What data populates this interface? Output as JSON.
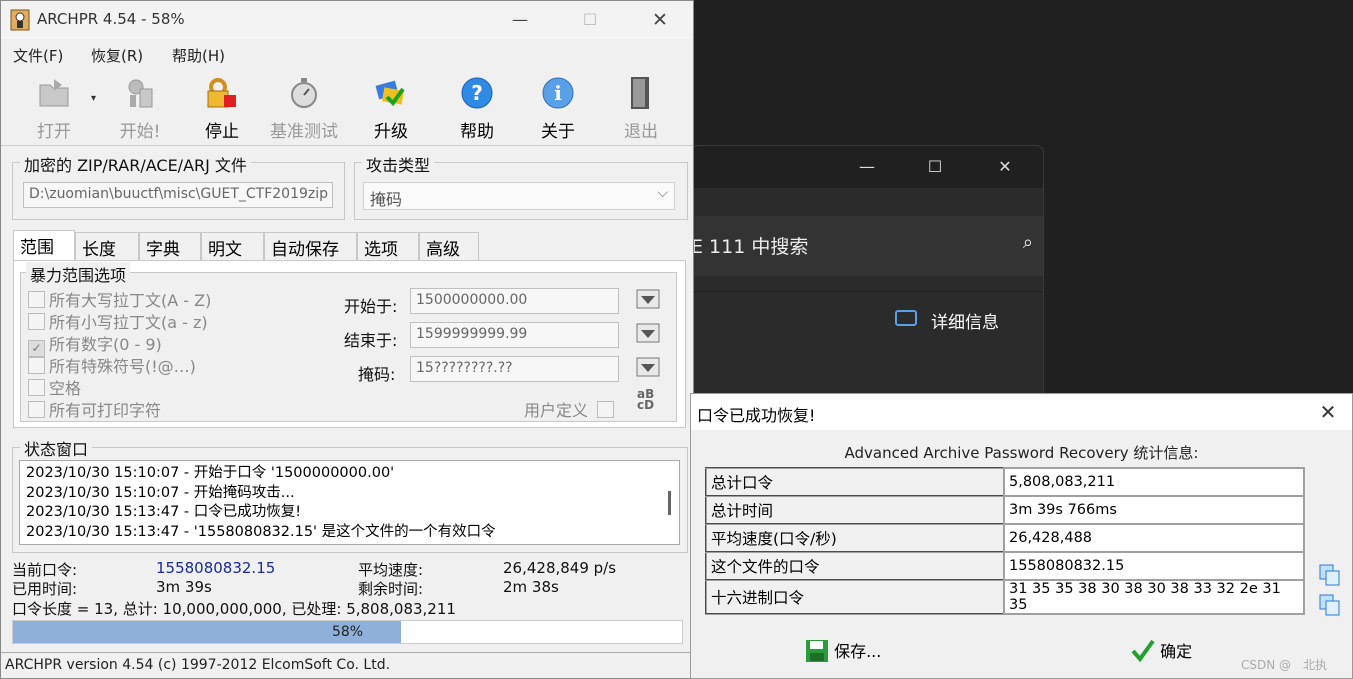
{
  "app": {
    "title": "ARCHPR 4.54 - 58%",
    "menu": [
      "文件(F)",
      "恢复(R)",
      "帮助(H)"
    ],
    "toolbar": [
      {
        "label": "打开",
        "icon": "open-folder-icon",
        "enabled": false
      },
      {
        "label": "开始!",
        "icon": "start-icon",
        "enabled": false
      },
      {
        "label": "停止",
        "icon": "stop-lock-icon",
        "enabled": true
      },
      {
        "label": "基准测试",
        "icon": "stopwatch-icon",
        "enabled": false
      },
      {
        "label": "升级",
        "icon": "upgrade-icon",
        "enabled": true
      },
      {
        "label": "帮助",
        "icon": "help-icon",
        "enabled": true
      },
      {
        "label": "关于",
        "icon": "info-icon",
        "enabled": true
      },
      {
        "label": "退出",
        "icon": "exit-door-icon",
        "enabled": false
      }
    ],
    "file_group": {
      "label": "加密的 ZIP/RAR/ACE/ARJ 文件",
      "path": "D:\\zuomian\\buuctf\\misc\\GUET_CTF2019zip"
    },
    "attack_group": {
      "label": "攻击类型",
      "selected": "掩码"
    },
    "tabs": [
      "范围",
      "长度",
      "字典",
      "明文",
      "自动保存",
      "选项",
      "高级"
    ],
    "range": {
      "group_label": "暴力范围选项",
      "checkboxes": [
        {
          "label": "所有大写拉丁文(A - Z)",
          "checked": false
        },
        {
          "label": "所有小写拉丁文(a - z)",
          "checked": false
        },
        {
          "label": "所有数字(0 - 9)",
          "checked": true
        },
        {
          "label": "所有特殊符号(!@…)",
          "checked": false
        },
        {
          "label": "空格",
          "checked": false
        },
        {
          "label": "所有可打印字符",
          "checked": false
        }
      ],
      "start_label": "开始于:",
      "start_value": "1500000000.00",
      "end_label": "结束于:",
      "end_value": "1599999999.99",
      "mask_label": "掩码:",
      "mask_value": "15????????.??",
      "custom_label": "用户定义"
    },
    "status_window": {
      "label": "状态窗口",
      "lines": [
        "2023/10/30 15:10:07 - 开始于口令 '1500000000.00'",
        "2023/10/30 15:10:07 - 开始掩码攻击...",
        "2023/10/30 15:13:47 - 口令已成功恢复!",
        "2023/10/30 15:13:47 - '1558080832.15' 是这个文件的一个有效口令"
      ]
    },
    "stats": {
      "current_label": "当前口令:",
      "current_value": "1558080832.15",
      "speed_label": "平均速度:",
      "speed_value": "26,428,849 p/s",
      "elapsed_label": "已用时间:",
      "elapsed_value": "3m 39s",
      "remaining_label": "剩余时间:",
      "remaining_value": "2m 38s",
      "summary": "口令长度 = 13, 总计: 10,000,000,000, 已处理: 5,808,083,211"
    },
    "progress": {
      "percent_text": "58%",
      "fraction": 0.58
    },
    "statusbar": "ARCHPR version 4.54 (c) 1997-2012 ElcomSoft Co. Ltd."
  },
  "background_window": {
    "search_text": "E 111 中搜索",
    "details_label": "详细信息"
  },
  "dialog": {
    "title": "口令已成功恢复!",
    "heading": "Advanced Archive Password Recovery 统计信息:",
    "rows": [
      {
        "key": "总计口令",
        "value": "5,808,083,211"
      },
      {
        "key": "总计时间",
        "value": "3m 39s 766ms"
      },
      {
        "key": "平均速度(口令/秒)",
        "value": "26,428,488"
      },
      {
        "key": "这个文件的口令",
        "value": "1558080832.15"
      },
      {
        "key": "十六进制口令",
        "value": "31 35 35 38 30 38 30 38 33 32 2e 31 35"
      }
    ],
    "save_label": "保存...",
    "ok_label": "确定"
  },
  "watermark": "CSDN @　北执"
}
